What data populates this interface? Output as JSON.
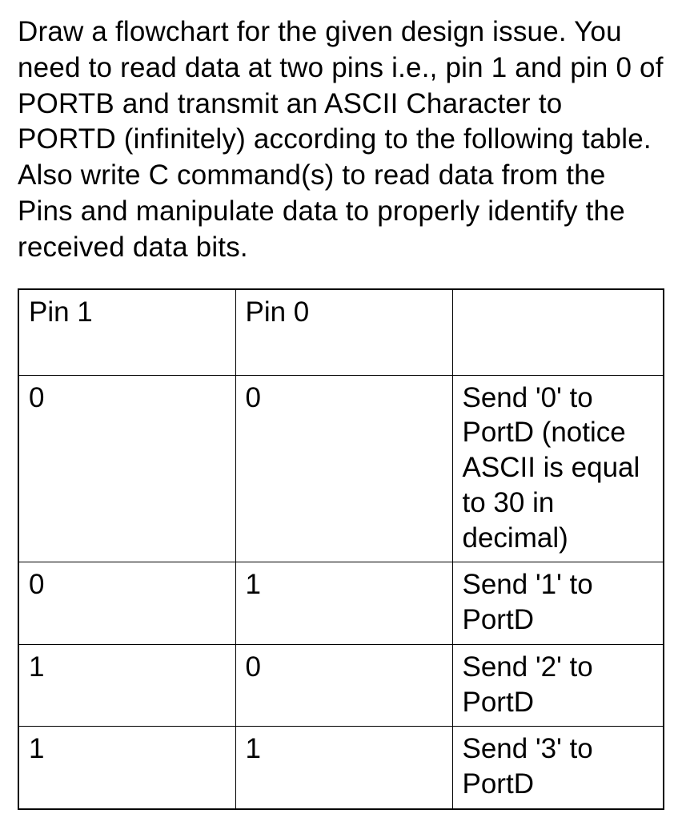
{
  "prompt_text": "Draw a flowchart for the given design issue. You need to read data at two pins i.e., pin 1 and pin 0 of PORTB and transmit an ASCII Character to PORTD (infinitely) according to the following table. Also write C command(s) to read data from the Pins and manipulate data to properly identify the received data bits.",
  "table": {
    "headers": {
      "col1": "Pin 1",
      "col2": "Pin 0",
      "col3": ""
    },
    "rows": [
      {
        "pin1": "0",
        "pin0": "0",
        "action": "Send '0' to PortD (notice ASCII is equal to 30 in decimal)"
      },
      {
        "pin1": "0",
        "pin0": "1",
        "action": "Send '1' to PortD"
      },
      {
        "pin1": "1",
        "pin0": "0",
        "action": "Send '2' to PortD"
      },
      {
        "pin1": "1",
        "pin0": "1",
        "action": "Send '3' to PortD"
      }
    ]
  }
}
